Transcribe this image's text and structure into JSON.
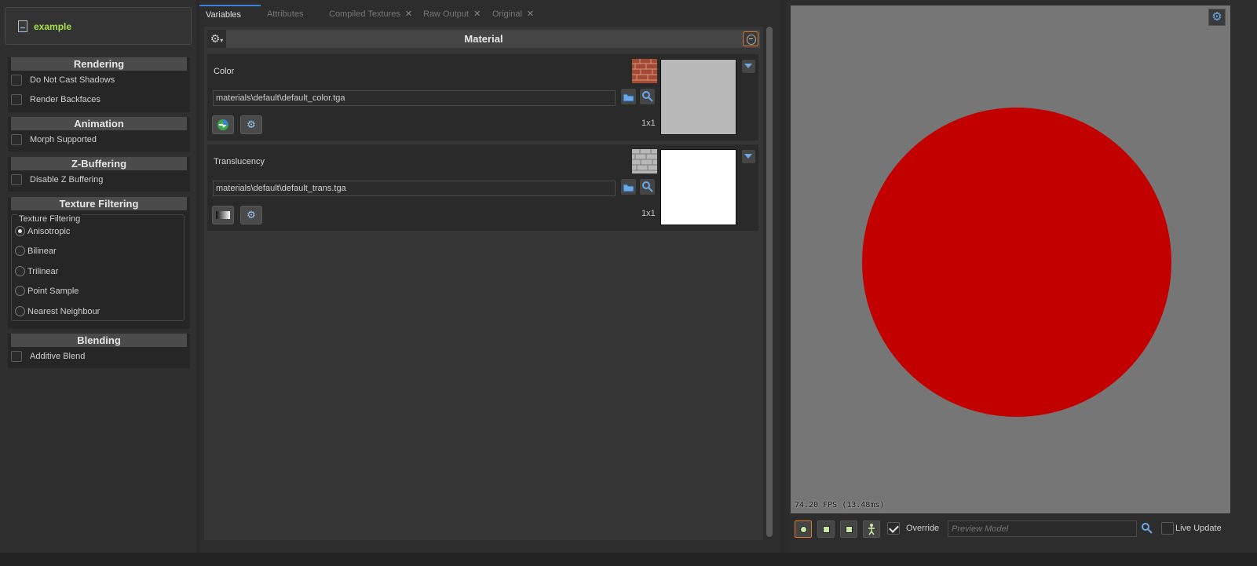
{
  "left_panel": {
    "material_name": "example",
    "rendering": {
      "title": "Rendering",
      "options": [
        {
          "label": "Do Not Cast Shadows",
          "checked": false
        },
        {
          "label": "Render Backfaces",
          "checked": false
        }
      ]
    },
    "animation": {
      "title": "Animation",
      "options": [
        {
          "label": "Morph Supported",
          "checked": false
        }
      ]
    },
    "zbuffering": {
      "title": "Z-Buffering",
      "options": [
        {
          "label": "Disable Z Buffering",
          "checked": false
        }
      ]
    },
    "texture_filtering": {
      "title": "Texture Filtering",
      "group_label": "Texture Filtering",
      "options": [
        {
          "label": "Anisotropic",
          "selected": true
        },
        {
          "label": "Bilinear",
          "selected": false
        },
        {
          "label": "Trilinear",
          "selected": false
        },
        {
          "label": "Point Sample",
          "selected": false
        },
        {
          "label": "Nearest Neighbour",
          "selected": false
        }
      ]
    },
    "blending": {
      "title": "Blending",
      "options": [
        {
          "label": "Additive Blend",
          "checked": false
        }
      ]
    }
  },
  "tabs": [
    {
      "label": "Variables",
      "active": true,
      "closable": false
    },
    {
      "label": "Attributes",
      "active": false,
      "closable": false
    },
    {
      "label": "Compiled Textures",
      "active": false,
      "closable": true
    },
    {
      "label": "Raw Output",
      "active": false,
      "closable": true
    },
    {
      "label": "Original",
      "active": false,
      "closable": true
    }
  ],
  "material": {
    "title": "Material",
    "textures": [
      {
        "name": "Color",
        "path": "materials\\default\\default_color.tga",
        "size": "1x1",
        "preview_color": "#b9b9b9",
        "thumb": "brick-texture"
      },
      {
        "name": "Translucency",
        "path": "materials\\default\\default_trans.tga",
        "size": "1x1",
        "preview_color": "#ffffff",
        "thumb": "grey-brick-texture"
      }
    ]
  },
  "viewport": {
    "fps": "74.20 FPS (13.48ms)",
    "sphere_color": "#c20000",
    "background_color": "#767676"
  },
  "viewport_toolbar": {
    "override_label": "Override",
    "override_checked": true,
    "preview_placeholder": "Preview Model",
    "live_update_label": "Live Update",
    "live_update_checked": false
  },
  "colors": {
    "accent": "#e07a2e",
    "tab_active": "#3a7fd6",
    "material_name": "#a6e04a"
  }
}
